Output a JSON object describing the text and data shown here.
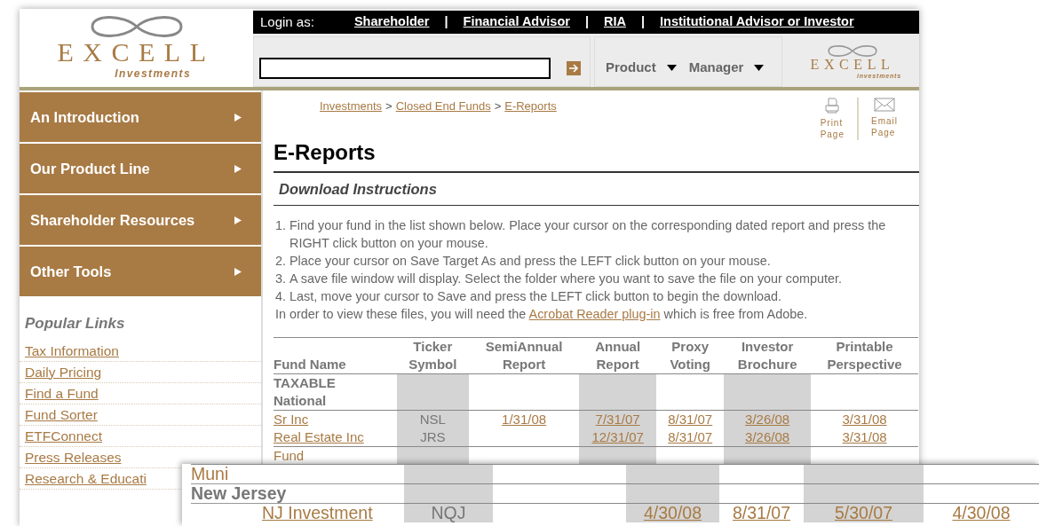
{
  "logo": {
    "name": "EXCELL",
    "tagline": "Investments"
  },
  "login_bar": {
    "label": "Login as:",
    "items": [
      {
        "kind": "link",
        "text": "Shareholder"
      },
      {
        "kind": "sep",
        "text": "|"
      },
      {
        "kind": "link",
        "text": "Financial Advisor"
      },
      {
        "kind": "sep",
        "text": "|"
      },
      {
        "kind": "link",
        "text": "RIA"
      },
      {
        "kind": "sep",
        "text": "|"
      },
      {
        "kind": "link",
        "text": "Institutional Advisor or Investor"
      }
    ]
  },
  "selectors": [
    {
      "label": "Product"
    },
    {
      "label": "Manager"
    }
  ],
  "header_logo": {
    "name": "EXCELL",
    "tagline": "investments"
  },
  "sidebar": {
    "items": [
      {
        "label": "An Introduction"
      },
      {
        "label": "Our Product Line"
      },
      {
        "label": "Shareholder Resources"
      },
      {
        "label": "Other Tools"
      }
    ]
  },
  "popular_links": {
    "title": "Popular Links",
    "links": [
      "Tax Information",
      "Daily Pricing",
      "Find a Fund",
      "Fund Sorter",
      "ETFConnect",
      "Press Releases",
      "Research & Educati"
    ]
  },
  "breadcrumb": {
    "items": [
      "Investments",
      "Closed End Funds",
      "E-Reports"
    ],
    "separator": ">"
  },
  "page_tools": [
    {
      "kind": "print",
      "lines": [
        "Print",
        "Page"
      ]
    },
    {
      "kind": "email",
      "lines": [
        "Email",
        "Page"
      ]
    }
  ],
  "title": "E-Reports",
  "section_title": "Download Instructions",
  "steps": [
    {
      "number": "1.",
      "text": "Find your fund in the list shown below. Place your cursor on the corresponding dated report and press the RIGHT click button on your mouse."
    },
    {
      "number": "2.",
      "text": "Place your cursor on Save Target As and press the LEFT click button on your mouse."
    },
    {
      "number": "3.",
      "text": "A save file window will display. Select the folder where you want to save the file on your computer."
    },
    {
      "number": "4.",
      "text": "Last, move your cursor to Save and press the LEFT click button to begin the download."
    }
  ],
  "note": {
    "before": "In order to view these files, you will need the ",
    "link": "Acrobat Reader plug-in",
    "after": " which is free from Adobe."
  },
  "table": {
    "columns": [
      {
        "lines": [
          "Fund Name"
        ]
      },
      {
        "lines": [
          "Ticker",
          "Symbol"
        ]
      },
      {
        "lines": [
          "SemiAnnual",
          "Report"
        ]
      },
      {
        "lines": [
          "Annual",
          "Report"
        ]
      },
      {
        "lines": [
          "Proxy",
          "Voting"
        ]
      },
      {
        "lines": [
          "Investor",
          "Brochure"
        ]
      },
      {
        "lines": [
          "Printable",
          "Perspective"
        ]
      }
    ],
    "rows": [
      {
        "kind": "group",
        "text": "TAXABLE"
      },
      {
        "kind": "group",
        "text": "National"
      },
      {
        "kind": "fund",
        "name": "Sr Inc",
        "ticker": "NSL",
        "semiannual": "1/31/08",
        "annual": "7/31/07",
        "proxy": "8/31/07",
        "brochure": "3/26/08",
        "printable": "3/31/08"
      },
      {
        "kind": "fund",
        "name": "Real Estate Inc",
        "ticker": "JRS",
        "annual": "12/31/07",
        "proxy": "8/31/07",
        "brochure": "3/26/08",
        "printable": "3/31/08"
      },
      {
        "kind": "group_link",
        "text": "Fund"
      }
    ]
  },
  "zoomed_inset": {
    "rows": [
      {
        "kind": "group_link",
        "text": "Muni"
      },
      {
        "kind": "group",
        "text": "New Jersey"
      },
      {
        "kind": "fund",
        "name": "NJ Investment",
        "ticker": "NQJ",
        "annual": "4/30/08",
        "proxy": "8/31/07",
        "brochure": "5/30/07",
        "printable": "4/30/08"
      }
    ]
  }
}
